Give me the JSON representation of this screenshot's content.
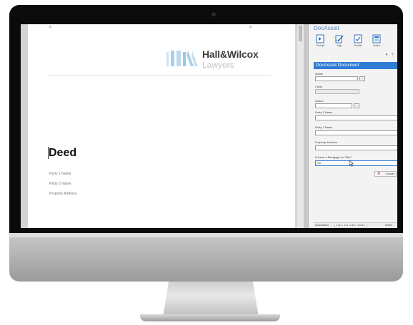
{
  "document": {
    "logo_name": "Hall&Wilcox",
    "logo_subtitle": "Lawyers",
    "title": "Deed",
    "fields": [
      "Party 1 Name",
      "Party 2 Name",
      "Property Address"
    ]
  },
  "pane": {
    "title": "DocAssist",
    "ribbon": [
      {
        "label": "Prompt",
        "icon": "prompt-icon"
      },
      {
        "label": "Sign",
        "icon": "sign-icon"
      },
      {
        "label": "Proofer",
        "icon": "proofer-icon"
      },
      {
        "label": "Notes",
        "icon": "notes-icon"
      }
    ],
    "header": "DocAssist Document",
    "form": {
      "matter_label": "Matter",
      "client_label": "Client",
      "author_label": "Author",
      "party1_label": "Party 1 Name",
      "party2_label": "Party 2 Name",
      "property_label": "Property Address",
      "mortgage_label": "Is there a Mortgage on Title?",
      "mortgage_value": "No",
      "lookup_label": "...",
      "cancel_label": "Cancel"
    },
    "tabs": [
      "Automation",
      "Client and matter details",
      "Notes"
    ]
  },
  "colors": {
    "accent": "#2f7bd6",
    "pane_title": "#5a86c5",
    "logo_bar": "#a9d0ea",
    "cancel": "#d32020"
  }
}
